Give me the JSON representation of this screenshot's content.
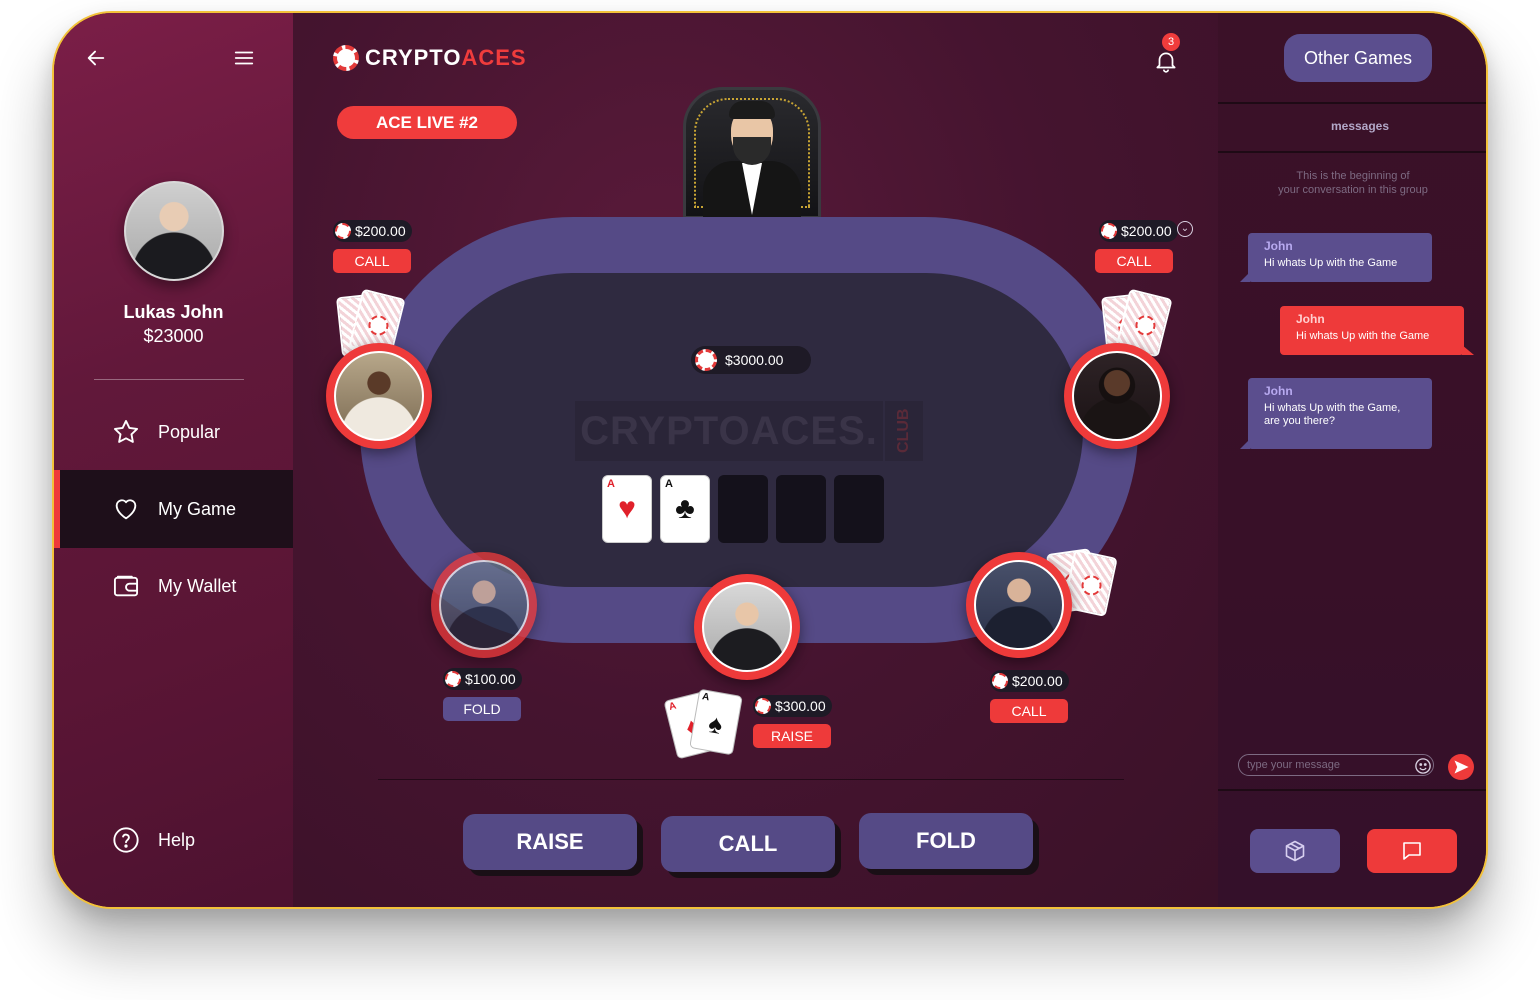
{
  "sidebar": {
    "user": {
      "name": "Lukas John",
      "balance": "$23000"
    },
    "nav": [
      {
        "label": "Popular",
        "icon": "star-icon"
      },
      {
        "label": "My Game",
        "icon": "heart-icon",
        "active": true
      },
      {
        "label": "My Wallet",
        "icon": "wallet-icon"
      }
    ],
    "help_label": "Help"
  },
  "header": {
    "logo_text_1": "CRYPTO",
    "logo_text_2": "ACES",
    "notifications_count": "3",
    "room_label": "ACE LIVE #2"
  },
  "table": {
    "pot": "$3000.00",
    "watermark_main": "CRYPTOACES.",
    "watermark_club": "CLUB",
    "board_cards": [
      {
        "rank": "A",
        "suit": "♥",
        "color": "red"
      },
      {
        "rank": "A",
        "suit": "♣",
        "color": "black"
      },
      {
        "hidden": true
      },
      {
        "hidden": true
      },
      {
        "hidden": true
      }
    ]
  },
  "players": {
    "top_left": {
      "bet": "$200.00",
      "action": "CALL"
    },
    "top_right": {
      "bet": "$200.00",
      "action": "CALL"
    },
    "bottom_left": {
      "bet": "$100.00",
      "action": "FOLD"
    },
    "me": {
      "bet": "$300.00",
      "action": "RAISE",
      "hand": [
        {
          "rank": "A",
          "suit": "♦"
        },
        {
          "rank": "A",
          "suit": "♠"
        }
      ]
    },
    "bottom_right": {
      "bet": "$200.00",
      "action": "CALL"
    }
  },
  "controls": {
    "raise": "RAISE",
    "call": "CALL",
    "fold": "FOLD"
  },
  "chat": {
    "other_games": "Other Games",
    "title": "messages",
    "intro_line1": "This is the beginning of",
    "intro_line2": "your conversation in this group",
    "messages": [
      {
        "author": "John",
        "text": "Hi whats Up with the Game",
        "side": "in"
      },
      {
        "author": "John",
        "text": "Hi whats Up with the Game",
        "side": "out"
      },
      {
        "author": "John",
        "text_line1": "Hi whats Up with the Game,",
        "text_line2": "are you there?",
        "side": "in"
      }
    ],
    "input_placeholder": "type your message"
  },
  "colors": {
    "accent_red": "#ee3a3a",
    "table_purple": "#554a86",
    "sidebar_active": "#1e0f1a",
    "border_gold": "#f3c23a"
  }
}
